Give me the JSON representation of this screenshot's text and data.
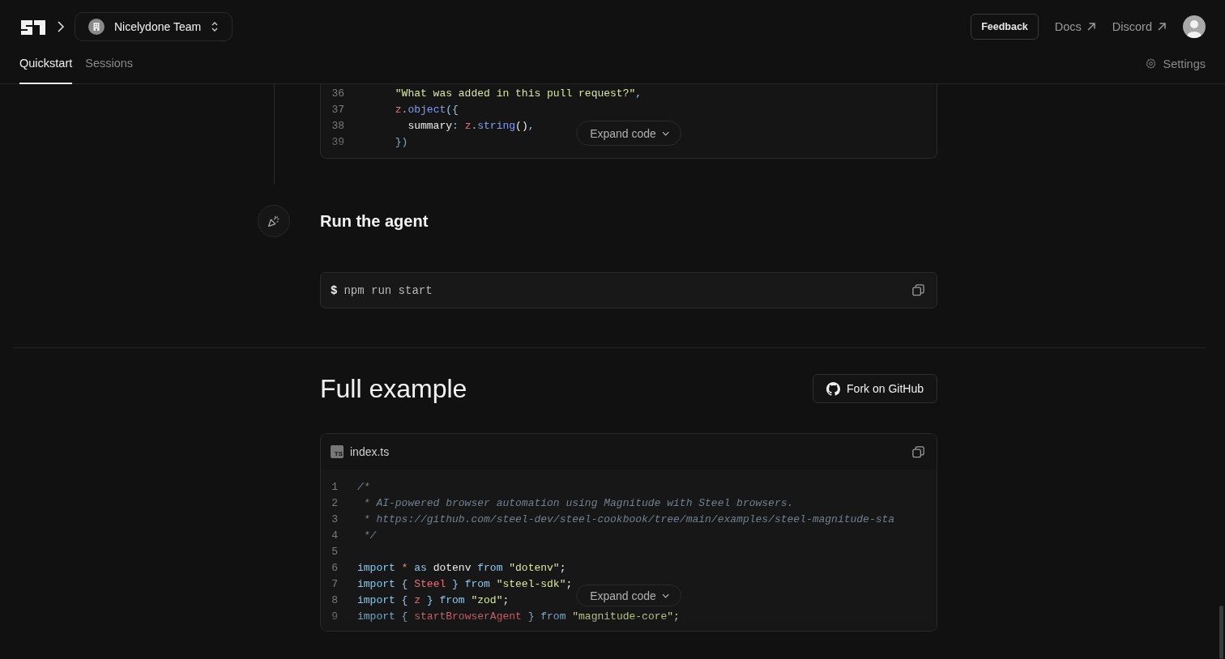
{
  "header": {
    "team": "Nicelydone Team",
    "feedback": "Feedback",
    "links": [
      {
        "label": "Docs"
      },
      {
        "label": "Discord"
      }
    ]
  },
  "tabs": [
    {
      "label": "Quickstart",
      "selected": true
    },
    {
      "label": "Sessions",
      "selected": false
    }
  ],
  "settings": "Settings",
  "snippet": {
    "lines": [
      {
        "n": "36",
        "tokens": [
          {
            "t": "      \"What was added in this pull request?\"",
            "kind": "string"
          },
          {
            "t": ",",
            "kind": "keyword"
          }
        ]
      },
      {
        "n": "37",
        "tokens": [
          {
            "t": "      z",
            "kind": "identifier"
          },
          {
            "t": ".",
            "kind": "keyword"
          },
          {
            "t": "object",
            "kind": "method"
          },
          {
            "t": "({",
            "kind": "keyword"
          }
        ]
      },
      {
        "n": "38",
        "tokens": [
          {
            "t": "        summary",
            "kind": "plain"
          },
          {
            "t": ": ",
            "kind": "keyword"
          },
          {
            "t": "z",
            "kind": "identifier"
          },
          {
            "t": ".",
            "kind": "keyword"
          },
          {
            "t": "string",
            "kind": "method"
          },
          {
            "t": "()",
            "kind": "plain"
          },
          {
            "t": ",",
            "kind": "keyword"
          }
        ]
      },
      {
        "n": "39",
        "tokens": [
          {
            "t": "      })",
            "kind": "keyword"
          }
        ]
      }
    ],
    "expand": "Expand code"
  },
  "step": {
    "title": "Run the agent",
    "prompt": "$",
    "command": "npm run start"
  },
  "example": {
    "title": "Full example",
    "fork": "Fork on GitHub",
    "file_badge": "TS",
    "filename": "index.ts",
    "lines": [
      {
        "n": "1",
        "tokens": [
          {
            "t": "/*",
            "kind": "comment"
          }
        ]
      },
      {
        "n": "2",
        "tokens": [
          {
            "t": " * AI-powered browser automation using Magnitude with Steel browsers.",
            "kind": "comment"
          }
        ]
      },
      {
        "n": "3",
        "tokens": [
          {
            "t": " * https://github.com/steel-dev/steel-cookbook/tree/main/examples/steel-magnitude-sta",
            "kind": "comment"
          }
        ]
      },
      {
        "n": "4",
        "tokens": [
          {
            "t": " */",
            "kind": "comment"
          }
        ]
      },
      {
        "n": "5"
      },
      {
        "n": "6",
        "tokens": [
          {
            "t": "import",
            "kind": "keyword"
          },
          {
            "t": " *",
            "kind": "operator"
          },
          {
            "t": " as",
            "kind": "keyword"
          },
          {
            "t": " dotenv",
            "kind": "plain"
          },
          {
            "t": " from",
            "kind": "keyword"
          },
          {
            "t": " \"dotenv\"",
            "kind": "string"
          },
          {
            "t": ";",
            "kind": "plain"
          }
        ]
      },
      {
        "n": "7",
        "tokens": [
          {
            "t": "import {",
            "kind": "keyword"
          },
          {
            "t": " Steel",
            "kind": "identifier"
          },
          {
            "t": " } from",
            "kind": "keyword"
          },
          {
            "t": " \"steel-sdk\"",
            "kind": "string"
          },
          {
            "t": ";",
            "kind": "plain"
          }
        ]
      },
      {
        "n": "8",
        "tokens": [
          {
            "t": "import {",
            "kind": "keyword"
          },
          {
            "t": " z",
            "kind": "identifier"
          },
          {
            "t": " } from",
            "kind": "keyword"
          },
          {
            "t": " \"zod\"",
            "kind": "string"
          },
          {
            "t": ";",
            "kind": "plain"
          }
        ]
      },
      {
        "n": "9",
        "tokens": [
          {
            "t": "import {",
            "kind": "keyword"
          },
          {
            "t": " startBrowserAgent",
            "kind": "identifier"
          },
          {
            "t": " } from",
            "kind": "keyword"
          },
          {
            "t": " \"magnitude-core\"",
            "kind": "string"
          },
          {
            "t": ";",
            "kind": "plain"
          }
        ]
      }
    ],
    "expand": "Expand code"
  }
}
